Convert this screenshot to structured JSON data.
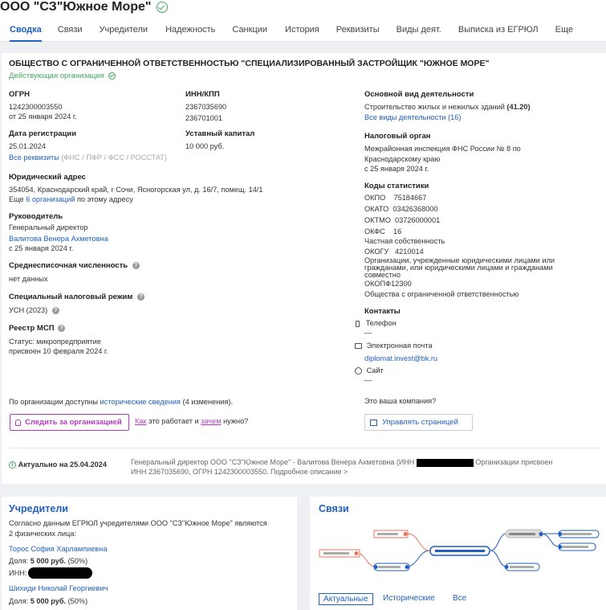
{
  "header": {
    "company_name": "ООО \"СЗ\"Южное Море\"",
    "tabs": [
      {
        "label": "Сводка"
      },
      {
        "label": "Связи"
      },
      {
        "label": "Учредители"
      },
      {
        "label": "Надежность"
      },
      {
        "label": "Санкции"
      },
      {
        "label": "История"
      },
      {
        "label": "Реквизиты"
      },
      {
        "label": "Виды деят."
      },
      {
        "label": "Выписка из ЕГРЮЛ"
      },
      {
        "label": "Еще"
      }
    ]
  },
  "summary": {
    "full_name": "ОБЩЕСТВО С ОГРАНИЧЕННОЙ ОТВЕТСТВЕННОСТЬЮ \"СПЕЦИАЛИЗИРОВАННЫЙ ЗАСТРОЙЩИК \"ЮЖНОЕ МОРЕ\"",
    "status": "Действующая организация",
    "ogrn_label": "ОГРН",
    "ogrn_value": "1242300003550",
    "ogrn_date": "от 25 января 2024 г.",
    "inn_kpp_label": "ИНН/КПП",
    "inn": "2367035690",
    "kpp": "236701001",
    "reg_date_label": "Дата регистрации",
    "reg_date": "25.01.2024",
    "all_requisites_link": "Все реквизиты",
    "requisites_sources": "(ФНС / ПФР / ФСС / РОССТАТ)",
    "capital_label": "Уставный капитал",
    "capital_value": "10 000 руб.",
    "address_label": "Юридический адрес",
    "address_value": "354054, Краснодарский край, г Сочи, Ясногорская ул, д. 16/7, помещ. 14/1",
    "address_more_prefix": "Еще",
    "address_more_link": "6 организаций",
    "address_more_suffix": "по этому адресу",
    "head_label": "Руководитель",
    "head_position": "Генеральный директор",
    "head_name": "Валитова Венера Ахметовна",
    "head_since": "с 25 января 2024 г.",
    "employees_label": "Среднесписочная численность",
    "employees_value": "нет данных",
    "tax_regime_label": "Специальный налоговый режим",
    "tax_regime_value": "УСН (2023)",
    "msp_label": "Реестр МСП",
    "msp_status": "Статус: микропредприятие",
    "msp_date": "присвоен 10 февраля 2024 г.",
    "main_activity_label": "Основной вид деятельности",
    "main_activity_value": "Строительство жилых и нежилых зданий",
    "main_activity_code": "(41.20)",
    "all_activities_link": "Все виды деятельности (16)",
    "tax_authority_label": "Налоговый орган",
    "tax_authority_line1": "Межрайонная инспекция ФНС России № 8 по",
    "tax_authority_line2": "Краснодарскому краю",
    "tax_authority_since": "с 25 января 2024 г.",
    "stat_codes_label": "Коды статистики",
    "okpo": "ОКПО    75184667",
    "okato": "ОКАТО  03426368000",
    "oktmo": "ОКТМО  03726000001",
    "okfs": "ОКФС    16",
    "okfs_desc": "Частная собственность",
    "okogu": "ОКОГУ   4210014",
    "okogu_desc_1": "Организации, учрежденные юридическими лицами или",
    "okogu_desc_2": "гражданами, или юридическими лицами и гражданами",
    "okogu_desc_3": "совместно",
    "okopf": "ОКОПФ12300",
    "okopf_desc": "Общества с ограниченной ответственностью",
    "contacts_label": "Контакты",
    "phone_label": "Телефон",
    "phone_value": "—",
    "email_label": "Электронная почта",
    "email_value": "diplomat.invest@bk.ru",
    "site_label": "Сайт",
    "site_value": "—",
    "history_prefix": "По организации доступны",
    "history_link": "исторические сведения",
    "history_suffix": "(4 изменения).",
    "follow_button": "Следить за организацией",
    "how_link": "Как",
    "how_middle": "это работает и",
    "why_link": "зачем",
    "how_suffix": "нужно?",
    "your_company": "Это ваша компания?",
    "manage_button": "Управлять страницей",
    "actual_label": "Актуально на 25.04.2024",
    "footer_line1_a": "Генеральный директор ООО \"СЗ\"Южное Море\" - Валитова Венера Ахметовна (ИНН",
    "footer_line1_b": "Организации присвоен",
    "footer_line2": "ИНН 2367035690, ОГРН 1242300003550. Подробное описание >"
  },
  "founders": {
    "title": "Учредители",
    "desc_1": "Согласно данным ЕГРЮЛ учредителями ООО \"СЗ\"Южное Море\" являются",
    "desc_2": "2 физических лица:",
    "share_label": "Доля:",
    "inn_label": "ИНН:",
    "items": [
      {
        "name": "Торос София Харлампиевна",
        "share": "5 000 руб.",
        "percent": "(50%)"
      },
      {
        "name": "Шихиди Николай Георгиевич",
        "share": "5 000 руб.",
        "percent": "(50%)"
      }
    ]
  },
  "links": {
    "title": "Связи",
    "tabs": [
      "Актуальные",
      "Исторические",
      "Все"
    ]
  },
  "colors": {
    "accent": "#1f5fbf",
    "success": "#41a85f",
    "follow": "#b43bc4",
    "graph_orange": "#e8735a"
  }
}
